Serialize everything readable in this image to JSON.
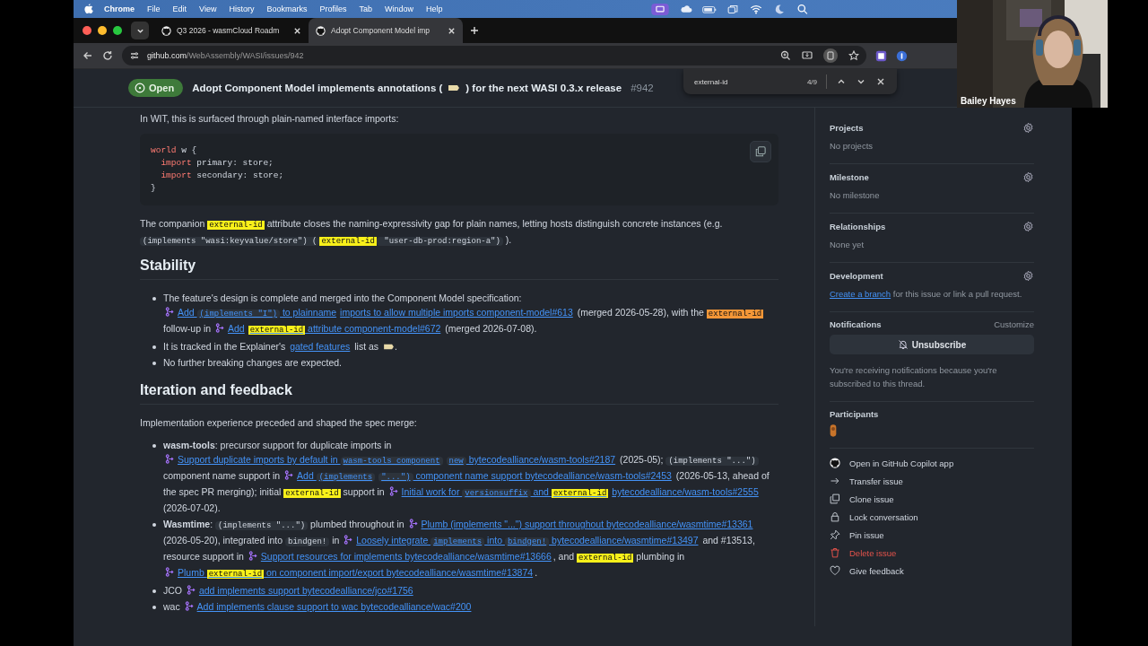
{
  "menubar": {
    "app": "Chrome",
    "items": [
      "File",
      "Edit",
      "View",
      "History",
      "Bookmarks",
      "Profiles",
      "Tab",
      "Window",
      "Help"
    ]
  },
  "tabs": [
    {
      "title": "Q3 2026 - wasmCloud Roadm",
      "selected": false
    },
    {
      "title": "Adopt Component Model imp",
      "selected": true
    }
  ],
  "address": {
    "host": "github.com",
    "path": "/WebAssembly/WASI/issues/942"
  },
  "find": {
    "query": "external-id",
    "count": "4/9"
  },
  "issue": {
    "state": "Open",
    "title": "Adopt Component Model implements annotations (",
    "title_end": ") for the next WASI 0.3.x release",
    "number": "#942"
  },
  "camera": {
    "name": "Bailey Hayes"
  },
  "body": [
    {
      "kind": "p",
      "segs": [
        {
          "kind": "text",
          "s": "In WIT, this is surfaced through plain-named interface imports:"
        }
      ]
    },
    {
      "kind": "code",
      "lines": [
        {
          "indent": false,
          "tokens": [
            {
              "kind": "keyword",
              "s": "world"
            },
            {
              "kind": "plain",
              "s": " w {"
            }
          ]
        },
        {
          "indent": true,
          "tokens": [
            {
              "kind": "keyword",
              "s": "import"
            },
            {
              "kind": "plain",
              "s": " primary: store;"
            }
          ]
        },
        {
          "indent": true,
          "tokens": [
            {
              "kind": "keyword",
              "s": "import"
            },
            {
              "kind": "plain",
              "s": " secondary: store;"
            }
          ]
        },
        {
          "indent": false,
          "tokens": [
            {
              "kind": "plain",
              "s": "}"
            }
          ]
        }
      ]
    },
    {
      "kind": "p",
      "segs": [
        {
          "kind": "text",
          "s": "The companion "
        },
        {
          "kind": "find",
          "s": "external-id",
          "current": false
        },
        {
          "kind": "text",
          "s": " attribute closes the naming-expressivity gap for plain names, letting hosts distinguish concrete instances (e.g. "
        },
        {
          "kind": "code",
          "s": "(implements \"wasi:keyvalue/store\") ("
        },
        {
          "kind": "find",
          "s": "external-id",
          "current": false
        },
        {
          "kind": "code",
          "s": " \"user-db-prod:region-a\")"
        },
        {
          "kind": "text",
          "s": " )."
        }
      ]
    },
    {
      "kind": "h2",
      "text": "Stability"
    },
    {
      "kind": "ul",
      "items": [
        [
          {
            "kind": "text",
            "s": "The feature's design is complete and merged into the Component Model specification: "
          },
          {
            "kind": "link",
            "pr": true,
            "parts": [
              {
                "kind": "text",
                "s": "Add "
              },
              {
                "kind": "code",
                "s": "(implements \"I\")"
              },
              {
                "kind": "text",
                "s": " to plainname"
              }
            ]
          },
          {
            "kind": "link",
            "pr": false,
            "parts": [
              {
                "kind": "text",
                "s": "imports to allow multiple imports component-model#613"
              }
            ]
          },
          {
            "kind": "text",
            "s": " (merged 2026-05-28), with the "
          },
          {
            "kind": "find",
            "s": "external-id",
            "current": true
          },
          {
            "kind": "text",
            "s": " follow-up in "
          },
          {
            "kind": "link",
            "pr": true,
            "parts": [
              {
                "kind": "text",
                "s": "Add"
              }
            ]
          },
          {
            "kind": "link",
            "pr": false,
            "parts": [
              {
                "kind": "find",
                "s": "external-id",
                "current": false
              },
              {
                "kind": "text",
                "s": " attribute component-model#672"
              }
            ]
          },
          {
            "kind": "text",
            "s": " (merged 2026-07-08)."
          }
        ],
        [
          {
            "kind": "text",
            "s": "It is tracked in the Explainer's "
          },
          {
            "kind": "link",
            "pr": false,
            "parts": [
              {
                "kind": "text",
                "s": "gated features"
              }
            ]
          },
          {
            "kind": "text",
            "s": " list as "
          },
          {
            "kind": "icon"
          },
          {
            "kind": "text",
            "s": "."
          }
        ],
        [
          {
            "kind": "text",
            "s": "No further breaking changes are expected."
          }
        ]
      ]
    },
    {
      "kind": "h2",
      "text": "Iteration and feedback"
    },
    {
      "kind": "p",
      "segs": [
        {
          "kind": "text",
          "s": "Implementation experience preceded and shaped the spec merge:"
        }
      ]
    },
    {
      "kind": "ul",
      "items": [
        [
          {
            "kind": "bold",
            "s": "wasm-tools"
          },
          {
            "kind": "text",
            "s": ": precursor support for duplicate imports in "
          },
          {
            "kind": "link",
            "pr": true,
            "parts": [
              {
                "kind": "text",
                "s": "Support duplicate imports by default in "
              },
              {
                "kind": "code",
                "s": "wasm-tools component"
              }
            ]
          },
          {
            "kind": "link",
            "pr": false,
            "parts": [
              {
                "kind": "code",
                "s": "new"
              },
              {
                "kind": "text",
                "s": " bytecodealliance/wasm-tools#2187"
              }
            ]
          },
          {
            "kind": "text",
            "s": " (2025-05); "
          },
          {
            "kind": "code",
            "s": "(implements \"...\")"
          },
          {
            "kind": "text",
            "s": " component name support in "
          },
          {
            "kind": "link",
            "pr": true,
            "parts": [
              {
                "kind": "text",
                "s": "Add "
              },
              {
                "kind": "code",
                "s": "(implements"
              }
            ]
          },
          {
            "kind": "link",
            "pr": false,
            "parts": [
              {
                "kind": "code",
                "s": "\"...\")"
              },
              {
                "kind": "text",
                "s": " component name support bytecodealliance/wasm-tools#2453"
              }
            ]
          },
          {
            "kind": "text",
            "s": " (2026-05-13, ahead of the spec PR merging); initial "
          },
          {
            "kind": "find",
            "s": "external-id",
            "current": false
          },
          {
            "kind": "text",
            "s": " support in "
          },
          {
            "kind": "link",
            "pr": true,
            "parts": [
              {
                "kind": "text",
                "s": "Initial work for "
              },
              {
                "kind": "code",
                "s": "versionsuffix"
              },
              {
                "kind": "text",
                "s": " and "
              },
              {
                "kind": "find",
                "s": "external-id",
                "current": false
              }
            ]
          },
          {
            "kind": "link",
            "pr": false,
            "parts": [
              {
                "kind": "text",
                "s": "bytecodealliance/wasm-tools#2555"
              }
            ]
          },
          {
            "kind": "text",
            "s": " (2026-07-02)."
          }
        ],
        [
          {
            "kind": "bold",
            "s": "Wasmtime"
          },
          {
            "kind": "text",
            "s": ": "
          },
          {
            "kind": "code",
            "s": "(implements \"...\")"
          },
          {
            "kind": "text",
            "s": " plumbed throughout in "
          },
          {
            "kind": "link",
            "pr": true,
            "parts": [
              {
                "kind": "text",
                "s": "Plumb (implements \"...\") support throughout bytecodealliance/wasmtime#13361"
              }
            ]
          },
          {
            "kind": "text",
            "s": " (2026-05-20), integrated into "
          },
          {
            "kind": "code",
            "s": "bindgen!"
          },
          {
            "kind": "text",
            "s": " in "
          },
          {
            "kind": "link",
            "pr": true,
            "parts": [
              {
                "kind": "text",
                "s": "Loosely integrate "
              },
              {
                "kind": "code",
                "s": "implements"
              },
              {
                "kind": "text",
                "s": " into "
              },
              {
                "kind": "code",
                "s": "bindgen!"
              },
              {
                "kind": "text",
                "s": " bytecodealliance/wasmtime#13497"
              }
            ]
          },
          {
            "kind": "text",
            "s": " and #13513, resource support in "
          },
          {
            "kind": "link",
            "pr": true,
            "parts": [
              {
                "kind": "text",
                "s": "Support resources for implements bytecodealliance/wasmtime#13666"
              }
            ]
          },
          {
            "kind": "text",
            "s": ", and "
          },
          {
            "kind": "find",
            "s": "external-id",
            "current": false
          },
          {
            "kind": "text",
            "s": " plumbing in "
          },
          {
            "kind": "link",
            "pr": true,
            "parts": [
              {
                "kind": "text",
                "s": "Plumb "
              },
              {
                "kind": "find",
                "s": "external-id",
                "current": false
              },
              {
                "kind": "text",
                "s": " on component import/export bytecodealliance/wasmtime#13874"
              }
            ]
          },
          {
            "kind": "text",
            "s": "."
          }
        ],
        [
          {
            "kind": "text",
            "s": "JCO "
          },
          {
            "kind": "link",
            "pr": true,
            "parts": [
              {
                "kind": "text",
                "s": "add implements support bytecodealliance/jco#1756"
              }
            ]
          }
        ],
        [
          {
            "kind": "text",
            "s": "wac "
          },
          {
            "kind": "link",
            "pr": true,
            "parts": [
              {
                "kind": "text",
                "s": "Add implements clause support to wac bytecodealliance/wac#200"
              }
            ]
          }
        ]
      ]
    }
  ],
  "sidebar": {
    "sections": [
      {
        "title": "Projects",
        "gear": true,
        "text": "No projects"
      },
      {
        "title": "Milestone",
        "gear": true,
        "text": "No milestone"
      },
      {
        "title": "Relationships",
        "gear": true,
        "text": "None yet"
      },
      {
        "title": "Development",
        "gear": true,
        "link": "Create a branch",
        "text": " for this issue or link a pull request."
      }
    ],
    "notifications": {
      "title": "Notifications",
      "customize": "Customize",
      "button": "Unsubscribe",
      "note": "You're receiving notifications because you're subscribed to this thread."
    },
    "participants": {
      "title": "Participants"
    },
    "actions": [
      {
        "label": "Open in GitHub Copilot app",
        "kind": "github",
        "danger": false
      },
      {
        "label": "Transfer issue",
        "kind": "arrow",
        "danger": false
      },
      {
        "label": "Clone issue",
        "kind": "copy",
        "danger": false
      },
      {
        "label": "Lock conversation",
        "kind": "lock",
        "danger": false
      },
      {
        "label": "Pin issue",
        "kind": "pin",
        "danger": false
      },
      {
        "label": "Delete issue",
        "kind": "trash",
        "danger": true
      },
      {
        "label": "Give feedback",
        "kind": "heart",
        "danger": false
      }
    ]
  }
}
